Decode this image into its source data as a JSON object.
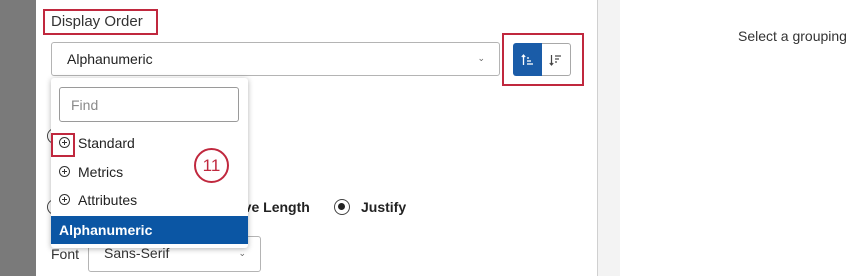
{
  "panel": {
    "display_order_label": "Display Order",
    "display_order_value": "Alphanumeric",
    "sort_ascending": "sort-ascending-icon",
    "sort_descending": "sort-descending-icon"
  },
  "dropdown": {
    "find_placeholder": "Find",
    "items": [
      {
        "label": "Standard",
        "icon": "plus-circle-icon"
      },
      {
        "label": "Metrics",
        "icon": "plus-circle-icon"
      },
      {
        "label": "Attributes",
        "icon": "plus-circle-icon"
      }
    ],
    "selected": "Alphanumeric"
  },
  "bar_width": {
    "option_partial": "sive Length",
    "option_justify": "Justify"
  },
  "font": {
    "label": "Font",
    "value": "Sans-Serif"
  },
  "right_pane": {
    "message": "Select a grouping"
  },
  "annotation": {
    "step_number": "11"
  },
  "colors": {
    "accent": "#0b56a4",
    "highlight": "#c0283e"
  }
}
